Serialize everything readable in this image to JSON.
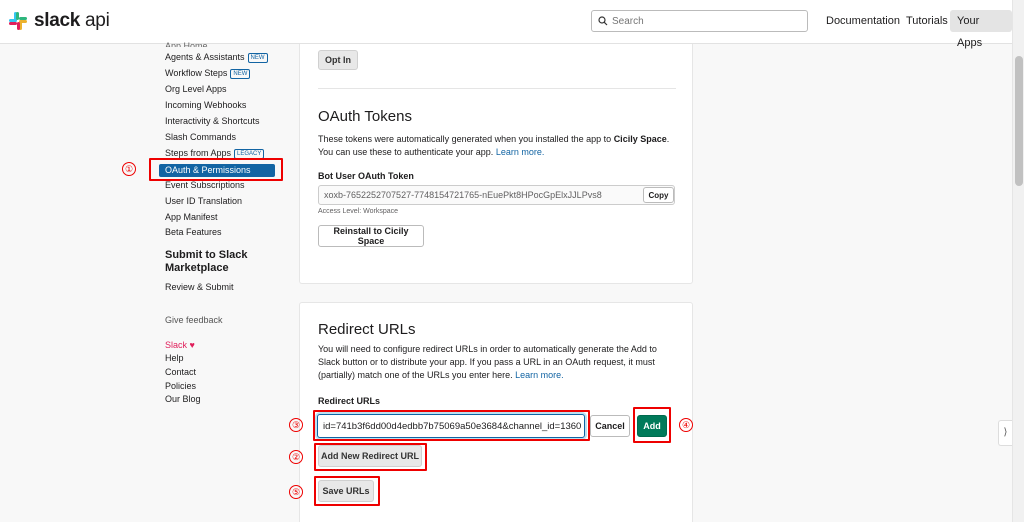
{
  "header": {
    "logo_slack": "slack",
    "logo_api": "api",
    "search_placeholder": "Search",
    "nav": [
      "Documentation",
      "Tutorials",
      "Your Apps"
    ]
  },
  "sidebar": {
    "cut_item": "App Home",
    "items": [
      {
        "label": "Agents & Assistants",
        "badge": "NEW"
      },
      {
        "label": "Workflow Steps",
        "badge": "NEW"
      },
      {
        "label": "Org Level Apps"
      },
      {
        "label": "Incoming Webhooks"
      },
      {
        "label": "Interactivity & Shortcuts"
      },
      {
        "label": "Slash Commands"
      },
      {
        "label": "Steps from Apps",
        "badge": "LEGACY"
      },
      {
        "label": "OAuth & Permissions",
        "active": true
      },
      {
        "label": "Event Subscriptions"
      },
      {
        "label": "User ID Translation"
      },
      {
        "label": "App Manifest"
      },
      {
        "label": "Beta Features"
      }
    ],
    "section_heading": "Submit to Slack Marketplace",
    "review_submit": "Review & Submit",
    "feedback": "Give feedback",
    "footer": [
      "Slack",
      "Help",
      "Contact",
      "Policies",
      "Our Blog"
    ]
  },
  "oauth_card": {
    "opt_in": "Opt In",
    "title": "OAuth Tokens",
    "desc_1": "These tokens were automatically generated when you installed the app to ",
    "workspace": "Cicily Space",
    "desc_2": ".",
    "desc_3": "You can use these to authenticate your app. ",
    "learn_more": "Learn more.",
    "bot_label": "Bot User OAuth Token",
    "token": "xoxb-7652252707527-7748154721765-nEuePkt8HPocGpElxJJLPvs8",
    "copy": "Copy",
    "access_level": "Access Level: Workspace",
    "reinstall": "Reinstall to Cicily Space"
  },
  "redirect_card": {
    "title": "Redirect URLs",
    "desc": "You will need to configure redirect URLs in order to automatically generate the Add to Slack button or to distribute your app. If you pass a URL in an OAuth request, it must (partially) match one of the URLs you enter here. ",
    "learn_more": "Learn more.",
    "label": "Redirect URLs",
    "url_value": "id=741b3f6dd00d4edbb7b75069a50e3684&channel_id=1360",
    "cancel": "Cancel",
    "add": "Add",
    "add_new": "Add New Redirect URL",
    "save": "Save URLs"
  },
  "annotations": [
    "①",
    "②",
    "③",
    "④",
    "⑤"
  ],
  "colors": {
    "accent": "#1264a3",
    "green": "#007a5a",
    "annotation": "#ee0000",
    "slack_red": "#e01e5a"
  }
}
